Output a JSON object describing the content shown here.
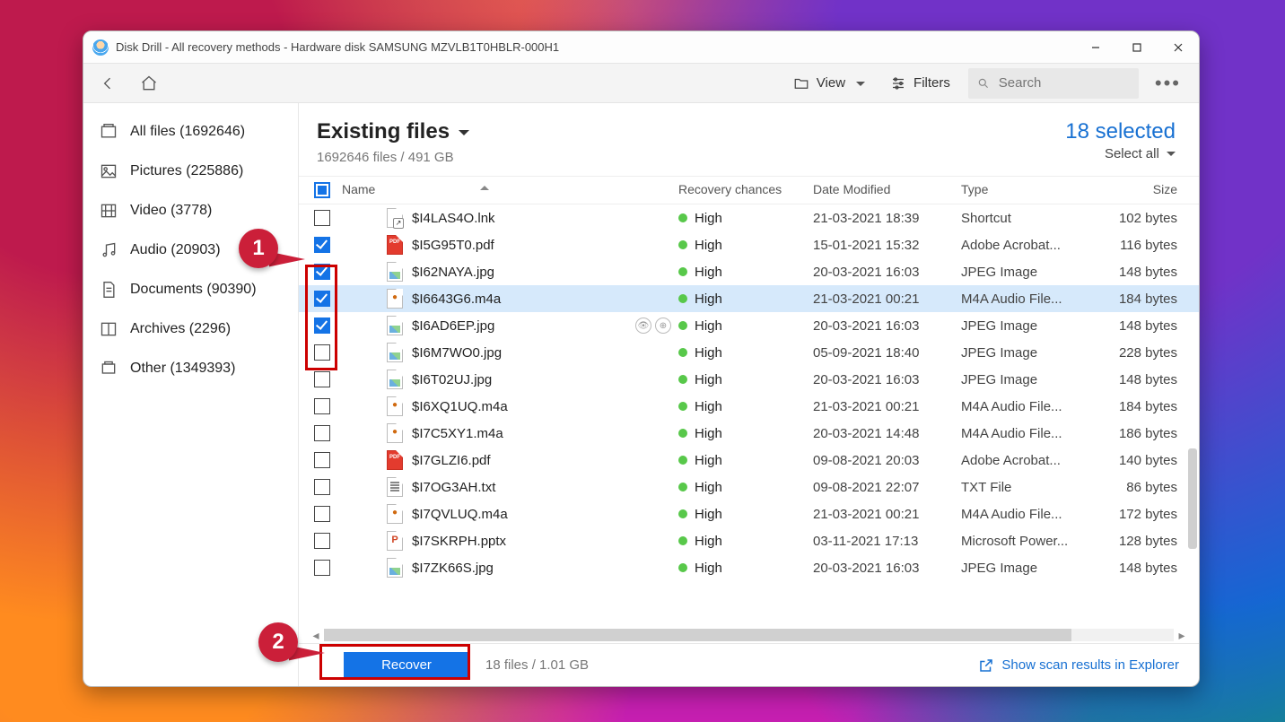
{
  "window": {
    "title": "Disk Drill - All recovery methods - Hardware disk SAMSUNG MZVLB1T0HBLR-000H1"
  },
  "toolbar": {
    "view": "View",
    "filters": "Filters",
    "search_placeholder": "Search"
  },
  "sidebar": {
    "items": [
      {
        "label": "All files (1692646)"
      },
      {
        "label": "Pictures (225886)"
      },
      {
        "label": "Video (3778)"
      },
      {
        "label": "Audio (20903)"
      },
      {
        "label": "Documents (90390)"
      },
      {
        "label": "Archives (2296)"
      },
      {
        "label": "Other (1349393)"
      }
    ]
  },
  "header": {
    "title": "Existing files",
    "subtitle": "1692646 files / 491 GB",
    "selected": "18 selected",
    "select_all": "Select all"
  },
  "columns": {
    "name": "Name",
    "recovery": "Recovery chances",
    "date": "Date Modified",
    "type": "Type",
    "size": "Size"
  },
  "rows": [
    {
      "checked": false,
      "selected": false,
      "icon": "lnk",
      "name": "$I4LAS4O.lnk",
      "rec": "High",
      "date": "21-03-2021 18:39",
      "type": "Shortcut",
      "size": "102 bytes",
      "hover": false
    },
    {
      "checked": true,
      "selected": false,
      "icon": "pdf",
      "name": "$I5G95T0.pdf",
      "rec": "High",
      "date": "15-01-2021 15:32",
      "type": "Adobe Acrobat...",
      "size": "116 bytes",
      "hover": false
    },
    {
      "checked": true,
      "selected": false,
      "icon": "img",
      "name": "$I62NAYA.jpg",
      "rec": "High",
      "date": "20-03-2021 16:03",
      "type": "JPEG Image",
      "size": "148 bytes",
      "hover": false
    },
    {
      "checked": true,
      "selected": true,
      "icon": "audio",
      "name": "$I6643G6.m4a",
      "rec": "High",
      "date": "21-03-2021 00:21",
      "type": "M4A Audio File...",
      "size": "184 bytes",
      "hover": false
    },
    {
      "checked": true,
      "selected": false,
      "icon": "img",
      "name": "$I6AD6EP.jpg",
      "rec": "High",
      "date": "20-03-2021 16:03",
      "type": "JPEG Image",
      "size": "148 bytes",
      "hover": true
    },
    {
      "checked": false,
      "selected": false,
      "icon": "img",
      "name": "$I6M7WO0.jpg",
      "rec": "High",
      "date": "05-09-2021 18:40",
      "type": "JPEG Image",
      "size": "228 bytes",
      "hover": false
    },
    {
      "checked": false,
      "selected": false,
      "icon": "img",
      "name": "$I6T02UJ.jpg",
      "rec": "High",
      "date": "20-03-2021 16:03",
      "type": "JPEG Image",
      "size": "148 bytes",
      "hover": false
    },
    {
      "checked": false,
      "selected": false,
      "icon": "audio",
      "name": "$I6XQ1UQ.m4a",
      "rec": "High",
      "date": "21-03-2021 00:21",
      "type": "M4A Audio File...",
      "size": "184 bytes",
      "hover": false
    },
    {
      "checked": false,
      "selected": false,
      "icon": "audio",
      "name": "$I7C5XY1.m4a",
      "rec": "High",
      "date": "20-03-2021 14:48",
      "type": "M4A Audio File...",
      "size": "186 bytes",
      "hover": false
    },
    {
      "checked": false,
      "selected": false,
      "icon": "pdf",
      "name": "$I7GLZI6.pdf",
      "rec": "High",
      "date": "09-08-2021 20:03",
      "type": "Adobe Acrobat...",
      "size": "140 bytes",
      "hover": false
    },
    {
      "checked": false,
      "selected": false,
      "icon": "txt",
      "name": "$I7OG3AH.txt",
      "rec": "High",
      "date": "09-08-2021 22:07",
      "type": "TXT File",
      "size": "86 bytes",
      "hover": false
    },
    {
      "checked": false,
      "selected": false,
      "icon": "audio",
      "name": "$I7QVLUQ.m4a",
      "rec": "High",
      "date": "21-03-2021 00:21",
      "type": "M4A Audio File...",
      "size": "172 bytes",
      "hover": false
    },
    {
      "checked": false,
      "selected": false,
      "icon": "pptx",
      "name": "$I7SKRPH.pptx",
      "rec": "High",
      "date": "03-11-2021 17:13",
      "type": "Microsoft Power...",
      "size": "128 bytes",
      "hover": false
    },
    {
      "checked": false,
      "selected": false,
      "icon": "img",
      "name": "$I7ZK66S.jpg",
      "rec": "High",
      "date": "20-03-2021 16:03",
      "type": "JPEG Image",
      "size": "148 bytes",
      "hover": false
    }
  ],
  "footer": {
    "recover": "Recover",
    "info": "18 files / 1.01 GB",
    "explorer": "Show scan results in Explorer"
  },
  "annotations": {
    "step1": "1",
    "step2": "2"
  }
}
